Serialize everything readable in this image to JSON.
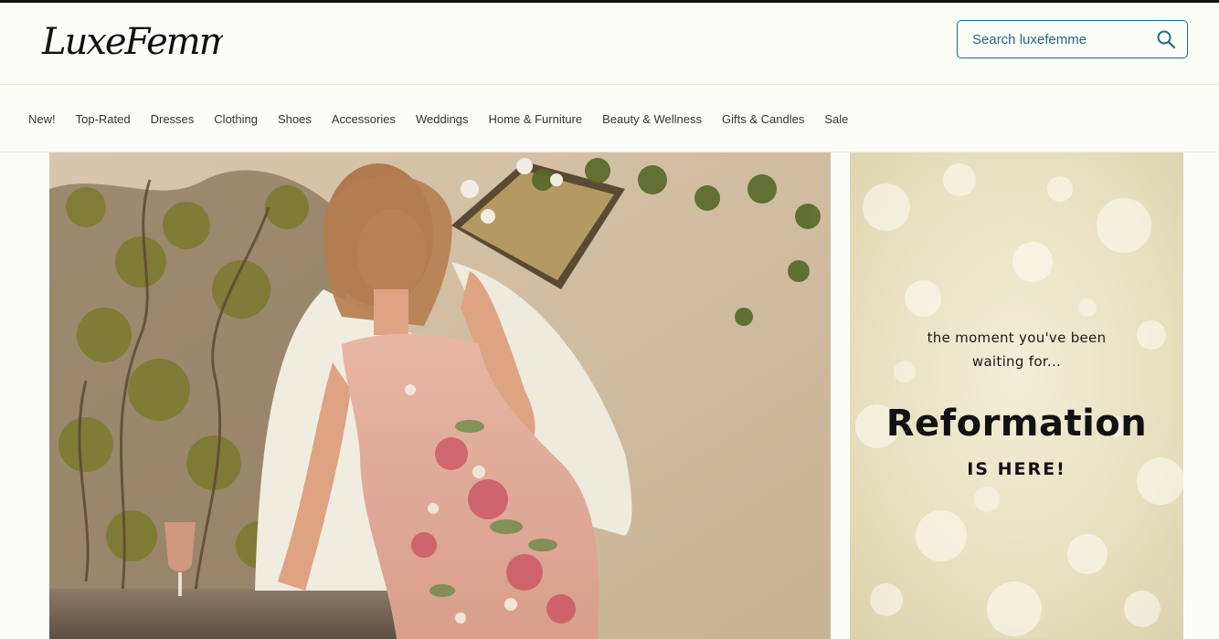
{
  "header": {
    "logo_text": "LuxeFemme",
    "search": {
      "placeholder": "Search luxefemme",
      "value": ""
    }
  },
  "nav": {
    "items": [
      {
        "label": "New!"
      },
      {
        "label": "Top-Rated"
      },
      {
        "label": "Dresses"
      },
      {
        "label": "Clothing"
      },
      {
        "label": "Shoes"
      },
      {
        "label": "Accessories"
      },
      {
        "label": "Weddings"
      },
      {
        "label": "Home & Furniture"
      },
      {
        "label": "Beauty & Wellness"
      },
      {
        "label": "Gifts & Candles"
      },
      {
        "label": "Sale"
      }
    ]
  },
  "promo": {
    "teaser": "the moment you've been waiting for...",
    "brand": "Reformation",
    "tagline": "IS HERE!"
  },
  "colors": {
    "accent": "#1d6b80",
    "page_background": "#fdfdf8"
  },
  "icons": {
    "search": "search-icon",
    "logo": "luxefemme-logo"
  }
}
